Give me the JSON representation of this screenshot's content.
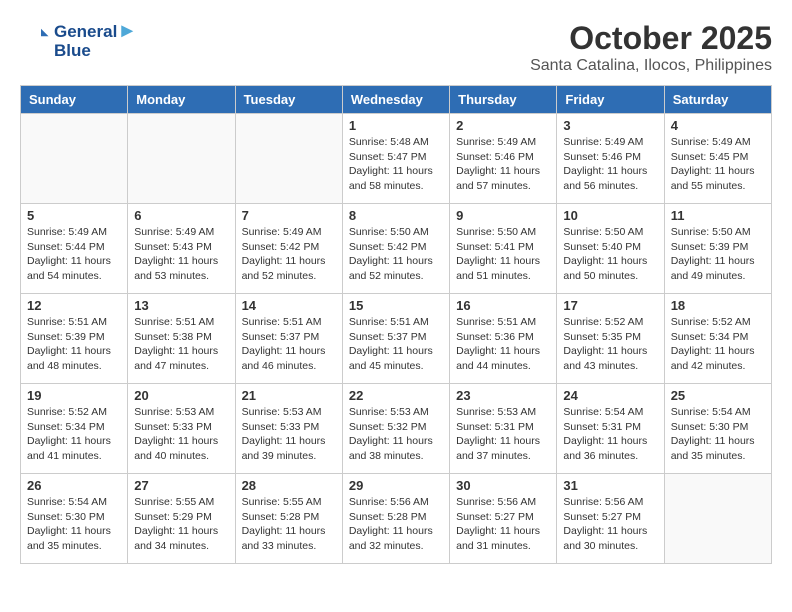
{
  "header": {
    "logo_line1": "General",
    "logo_line2": "Blue",
    "month": "October 2025",
    "location": "Santa Catalina, Ilocos, Philippines"
  },
  "days_of_week": [
    "Sunday",
    "Monday",
    "Tuesday",
    "Wednesday",
    "Thursday",
    "Friday",
    "Saturday"
  ],
  "weeks": [
    [
      {
        "day": "",
        "info": ""
      },
      {
        "day": "",
        "info": ""
      },
      {
        "day": "",
        "info": ""
      },
      {
        "day": "1",
        "info": "Sunrise: 5:48 AM\nSunset: 5:47 PM\nDaylight: 11 hours\nand 58 minutes."
      },
      {
        "day": "2",
        "info": "Sunrise: 5:49 AM\nSunset: 5:46 PM\nDaylight: 11 hours\nand 57 minutes."
      },
      {
        "day": "3",
        "info": "Sunrise: 5:49 AM\nSunset: 5:46 PM\nDaylight: 11 hours\nand 56 minutes."
      },
      {
        "day": "4",
        "info": "Sunrise: 5:49 AM\nSunset: 5:45 PM\nDaylight: 11 hours\nand 55 minutes."
      }
    ],
    [
      {
        "day": "5",
        "info": "Sunrise: 5:49 AM\nSunset: 5:44 PM\nDaylight: 11 hours\nand 54 minutes."
      },
      {
        "day": "6",
        "info": "Sunrise: 5:49 AM\nSunset: 5:43 PM\nDaylight: 11 hours\nand 53 minutes."
      },
      {
        "day": "7",
        "info": "Sunrise: 5:49 AM\nSunset: 5:42 PM\nDaylight: 11 hours\nand 52 minutes."
      },
      {
        "day": "8",
        "info": "Sunrise: 5:50 AM\nSunset: 5:42 PM\nDaylight: 11 hours\nand 52 minutes."
      },
      {
        "day": "9",
        "info": "Sunrise: 5:50 AM\nSunset: 5:41 PM\nDaylight: 11 hours\nand 51 minutes."
      },
      {
        "day": "10",
        "info": "Sunrise: 5:50 AM\nSunset: 5:40 PM\nDaylight: 11 hours\nand 50 minutes."
      },
      {
        "day": "11",
        "info": "Sunrise: 5:50 AM\nSunset: 5:39 PM\nDaylight: 11 hours\nand 49 minutes."
      }
    ],
    [
      {
        "day": "12",
        "info": "Sunrise: 5:51 AM\nSunset: 5:39 PM\nDaylight: 11 hours\nand 48 minutes."
      },
      {
        "day": "13",
        "info": "Sunrise: 5:51 AM\nSunset: 5:38 PM\nDaylight: 11 hours\nand 47 minutes."
      },
      {
        "day": "14",
        "info": "Sunrise: 5:51 AM\nSunset: 5:37 PM\nDaylight: 11 hours\nand 46 minutes."
      },
      {
        "day": "15",
        "info": "Sunrise: 5:51 AM\nSunset: 5:37 PM\nDaylight: 11 hours\nand 45 minutes."
      },
      {
        "day": "16",
        "info": "Sunrise: 5:51 AM\nSunset: 5:36 PM\nDaylight: 11 hours\nand 44 minutes."
      },
      {
        "day": "17",
        "info": "Sunrise: 5:52 AM\nSunset: 5:35 PM\nDaylight: 11 hours\nand 43 minutes."
      },
      {
        "day": "18",
        "info": "Sunrise: 5:52 AM\nSunset: 5:34 PM\nDaylight: 11 hours\nand 42 minutes."
      }
    ],
    [
      {
        "day": "19",
        "info": "Sunrise: 5:52 AM\nSunset: 5:34 PM\nDaylight: 11 hours\nand 41 minutes."
      },
      {
        "day": "20",
        "info": "Sunrise: 5:53 AM\nSunset: 5:33 PM\nDaylight: 11 hours\nand 40 minutes."
      },
      {
        "day": "21",
        "info": "Sunrise: 5:53 AM\nSunset: 5:33 PM\nDaylight: 11 hours\nand 39 minutes."
      },
      {
        "day": "22",
        "info": "Sunrise: 5:53 AM\nSunset: 5:32 PM\nDaylight: 11 hours\nand 38 minutes."
      },
      {
        "day": "23",
        "info": "Sunrise: 5:53 AM\nSunset: 5:31 PM\nDaylight: 11 hours\nand 37 minutes."
      },
      {
        "day": "24",
        "info": "Sunrise: 5:54 AM\nSunset: 5:31 PM\nDaylight: 11 hours\nand 36 minutes."
      },
      {
        "day": "25",
        "info": "Sunrise: 5:54 AM\nSunset: 5:30 PM\nDaylight: 11 hours\nand 35 minutes."
      }
    ],
    [
      {
        "day": "26",
        "info": "Sunrise: 5:54 AM\nSunset: 5:30 PM\nDaylight: 11 hours\nand 35 minutes."
      },
      {
        "day": "27",
        "info": "Sunrise: 5:55 AM\nSunset: 5:29 PM\nDaylight: 11 hours\nand 34 minutes."
      },
      {
        "day": "28",
        "info": "Sunrise: 5:55 AM\nSunset: 5:28 PM\nDaylight: 11 hours\nand 33 minutes."
      },
      {
        "day": "29",
        "info": "Sunrise: 5:56 AM\nSunset: 5:28 PM\nDaylight: 11 hours\nand 32 minutes."
      },
      {
        "day": "30",
        "info": "Sunrise: 5:56 AM\nSunset: 5:27 PM\nDaylight: 11 hours\nand 31 minutes."
      },
      {
        "day": "31",
        "info": "Sunrise: 5:56 AM\nSunset: 5:27 PM\nDaylight: 11 hours\nand 30 minutes."
      },
      {
        "day": "",
        "info": ""
      }
    ]
  ]
}
